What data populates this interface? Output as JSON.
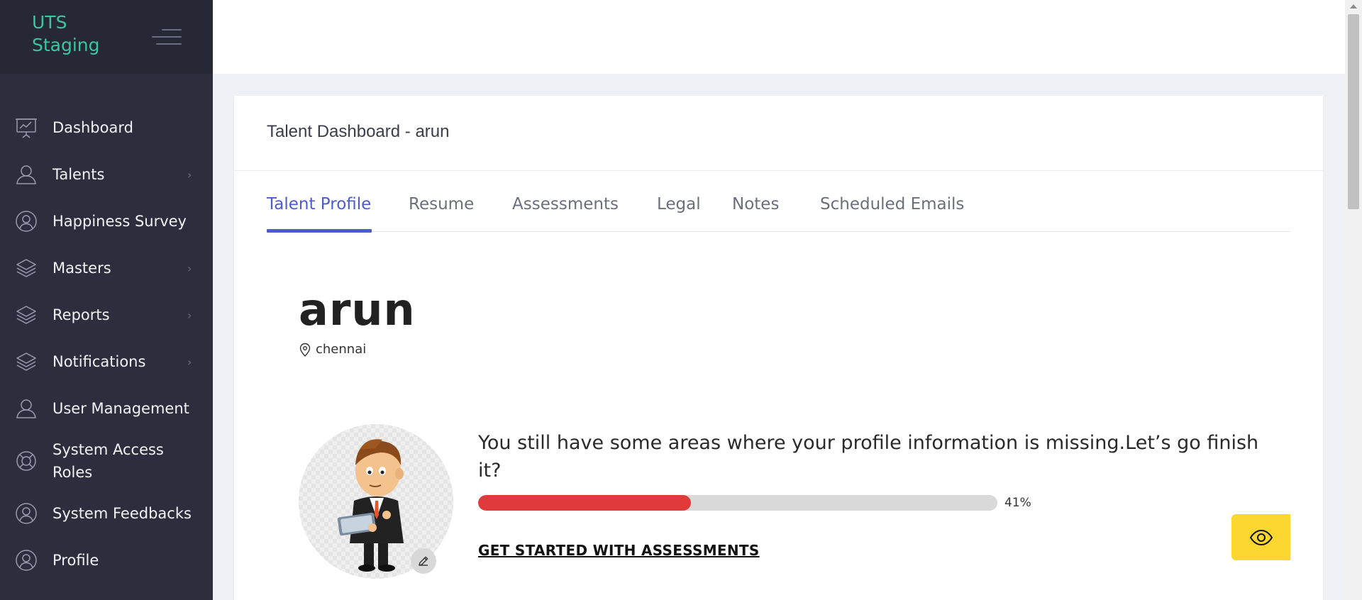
{
  "brand": {
    "title_line1": "UTS",
    "title_line2": "Staging"
  },
  "sidebar": {
    "items": [
      {
        "label": "Dashboard",
        "icon": "presentation-chart-icon",
        "has_submenu": false
      },
      {
        "label": "Talents",
        "icon": "user-icon",
        "has_submenu": true
      },
      {
        "label": "Happiness Survey",
        "icon": "user-circle-icon",
        "has_submenu": false
      },
      {
        "label": "Masters",
        "icon": "layers-icon",
        "has_submenu": true
      },
      {
        "label": "Reports",
        "icon": "layers-icon",
        "has_submenu": true
      },
      {
        "label": "Notifications",
        "icon": "layers-icon",
        "has_submenu": true
      },
      {
        "label": "User Management",
        "icon": "user-icon",
        "has_submenu": false
      },
      {
        "label_line1": "System Access",
        "label_line2": "Roles",
        "icon": "lifebuoy-icon",
        "has_submenu": false
      },
      {
        "label": "System Feedbacks",
        "icon": "user-circle-icon",
        "has_submenu": false
      },
      {
        "label": "Profile",
        "icon": "user-circle-icon",
        "has_submenu": false
      }
    ],
    "chevron": "›"
  },
  "card": {
    "title": "Talent Dashboard - arun",
    "tabs": [
      {
        "label": "Talent Profile",
        "active": true
      },
      {
        "label": "Resume",
        "active": false
      },
      {
        "label": "Assessments",
        "active": false
      },
      {
        "label": "Legal",
        "active": false
      },
      {
        "label": "Notes",
        "active": false
      },
      {
        "label": "Scheduled Emails",
        "active": false
      }
    ]
  },
  "profile": {
    "name": "arun",
    "location": "chennai",
    "missing_message": "You still have some areas where your profile information is missing.Let’s go finish it?",
    "completion_percent": 41,
    "completion_text": "41%",
    "cta": "GET STARTED WITH ASSESSMENTS"
  },
  "colors": {
    "sidebar_bg": "#2c2e3e",
    "brand": "#3cc5a0",
    "accent": "#4a5bd4",
    "progress": "#e03a3a",
    "view_button": "#fcd730"
  }
}
